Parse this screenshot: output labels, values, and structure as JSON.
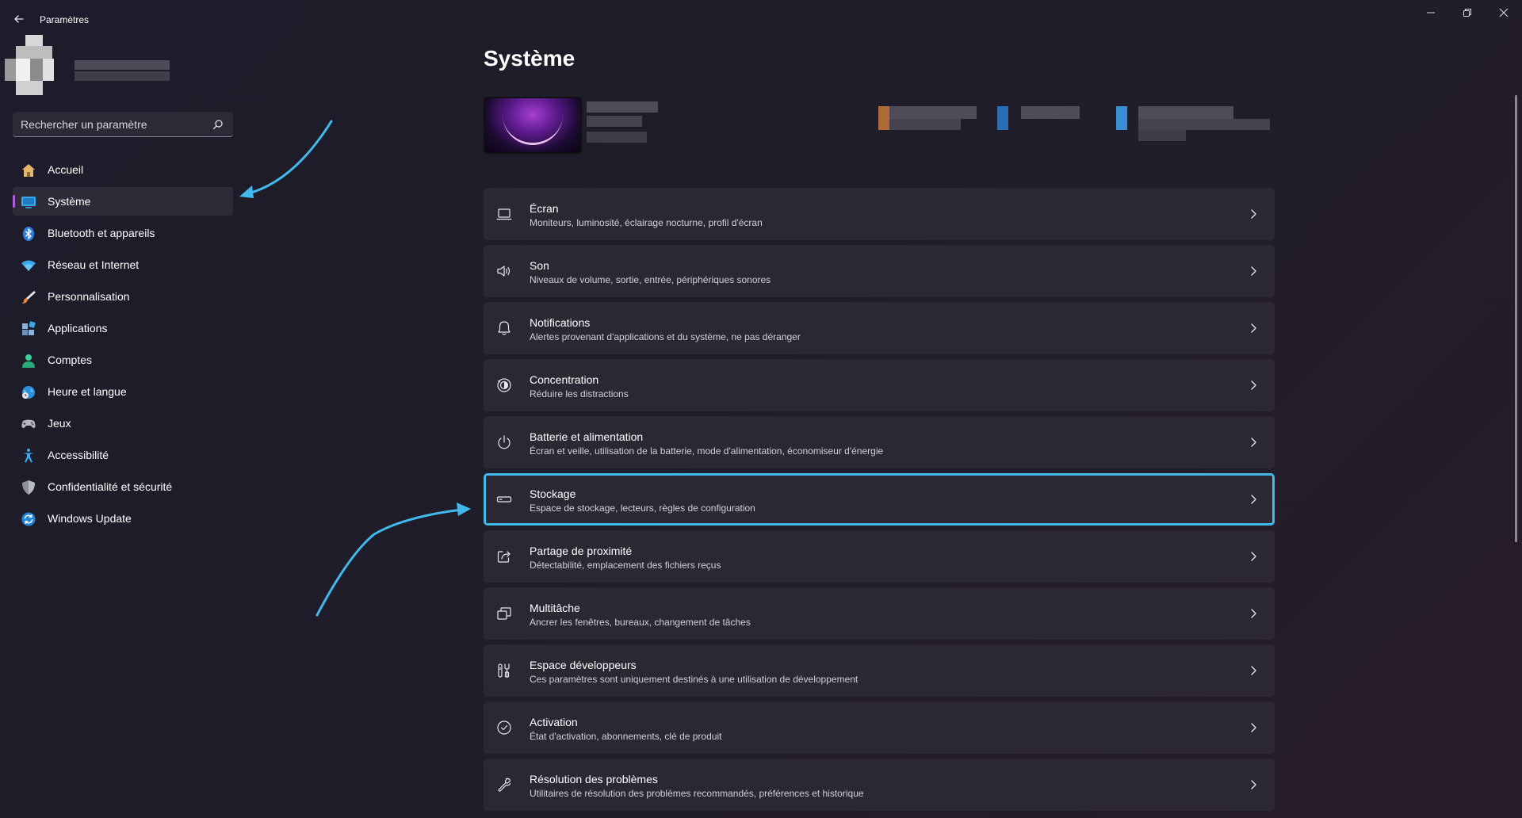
{
  "window": {
    "title": "Paramètres"
  },
  "search": {
    "placeholder": "Rechercher un paramètre"
  },
  "sidebar": {
    "items": [
      {
        "label": "Accueil",
        "icon": "home-icon",
        "selected": false
      },
      {
        "label": "Système",
        "icon": "monitor-icon",
        "selected": true
      },
      {
        "label": "Bluetooth et appareils",
        "icon": "bluetooth-icon",
        "selected": false
      },
      {
        "label": "Réseau et Internet",
        "icon": "wifi-icon",
        "selected": false
      },
      {
        "label": "Personnalisation",
        "icon": "brush-icon",
        "selected": false
      },
      {
        "label": "Applications",
        "icon": "apps-icon",
        "selected": false
      },
      {
        "label": "Comptes",
        "icon": "person-icon",
        "selected": false
      },
      {
        "label": "Heure et langue",
        "icon": "globe-clock-icon",
        "selected": false
      },
      {
        "label": "Jeux",
        "icon": "gamepad-icon",
        "selected": false
      },
      {
        "label": "Accessibilité",
        "icon": "accessibility-icon",
        "selected": false
      },
      {
        "label": "Confidentialité et sécurité",
        "icon": "shield-icon",
        "selected": false
      },
      {
        "label": "Windows Update",
        "icon": "update-icon",
        "selected": false
      }
    ]
  },
  "main": {
    "title": "Système",
    "cards": [
      {
        "title": "Écran",
        "desc": "Moniteurs, luminosité, éclairage nocturne, profil d'écran",
        "icon": "display-icon"
      },
      {
        "title": "Son",
        "desc": "Niveaux de volume, sortie, entrée, périphériques sonores",
        "icon": "speaker-icon"
      },
      {
        "title": "Notifications",
        "desc": "Alertes provenant d'applications et du système, ne pas déranger",
        "icon": "bell-icon"
      },
      {
        "title": "Concentration",
        "desc": "Réduire les distractions",
        "icon": "focus-icon"
      },
      {
        "title": "Batterie et alimentation",
        "desc": "Écran et veille, utilisation de la batterie, mode d'alimentation, économiseur d'énergie",
        "icon": "power-icon"
      },
      {
        "title": "Stockage",
        "desc": "Espace de stockage, lecteurs, règles de configuration",
        "icon": "storage-icon",
        "highlighted": true
      },
      {
        "title": "Partage de proximité",
        "desc": "Détectabilité, emplacement des fichiers reçus",
        "icon": "share-icon"
      },
      {
        "title": "Multitâche",
        "desc": "Ancrer les fenêtres, bureaux, changement de tâches",
        "icon": "multitask-icon"
      },
      {
        "title": "Espace développeurs",
        "desc": "Ces paramètres sont uniquement destinés à une utilisation de développement",
        "icon": "developer-tools-icon"
      },
      {
        "title": "Activation",
        "desc": "État d'activation, abonnements, clé de produit",
        "icon": "check-circle-icon"
      },
      {
        "title": "Résolution des problèmes",
        "desc": "Utilitaires de résolution des problèmes recommandés, préférences et historique",
        "icon": "wrench-icon"
      }
    ]
  },
  "colors": {
    "accent": "#b25ae0",
    "annotation": "#41b9ec",
    "card_bg": "#2b2833"
  }
}
